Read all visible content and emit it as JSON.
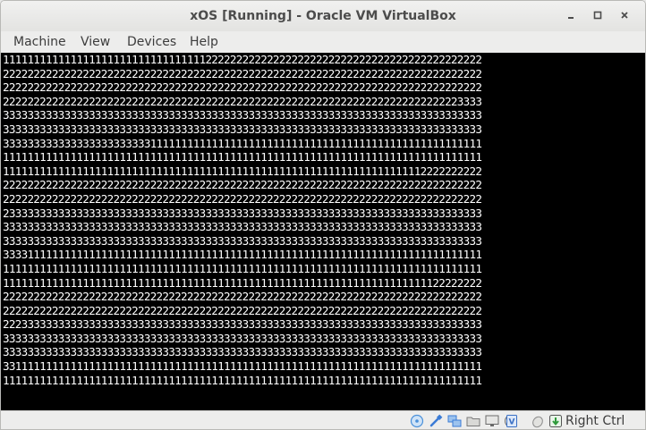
{
  "window": {
    "title": "xOS [Running] - Oracle VM VirtualBox"
  },
  "menubar": {
    "items": [
      {
        "label": "Machine"
      },
      {
        "label": "View"
      },
      {
        "label": "Devices"
      },
      {
        "label": "Help"
      }
    ]
  },
  "vm_screen": {
    "lines": [
      "111111111111111111111111111111111222222222222222222222222222222222222222222222",
      "222222222222222222222222222222222222222222222222222222222222222222222222222222",
      "222222222222222222222222222222222222222222222222222222222222222222222222222222",
      "222222222222222222222222222222222222222222222222222222222222222222222222223333",
      "333333333333333333333333333333333333333333333333333333333333333333333333333333",
      "333333333333333333333333333333333333333333333333333333333333333333333333333333",
      "333333333333333333333333111111111111111111111111111111111111111111111111111111",
      "111111111111111111111111111111111111111111111111111111111111111111111111111111",
      "111111111111111111111111111111111111111111111111111111111111111111112222222222",
      "222222222222222222222222222222222222222222222222222222222222222222222222222222",
      "222222222222222222222222222222222222222222222222222222222222222222222222222222",
      "233333333333333333333333333333333333333333333333333333333333333333333333333333",
      "333333333333333333333333333333333333333333333333333333333333333333333333333333",
      "333333333333333333333333333333333333333333333333333333333333333333333333333333",
      "333311111111111111111111111111111111111111111111111111111111111111111111111111",
      "111111111111111111111111111111111111111111111111111111111111111111111111111111",
      "111111111111111111111111111111111111111111111111111111111111111111111122222222",
      "222222222222222222222222222222222222222222222222222222222222222222222222222222",
      "222222222222222222222222222222222222222222222222222222222222222222222222222222",
      "222333333333333333333333333333333333333333333333333333333333333333333333333333",
      "333333333333333333333333333333333333333333333333333333333333333333333333333333",
      "333333333333333333333333333333333333333333333333333333333333333333333333333333",
      "331111111111111111111111111111111111111111111111111111111111111111111111111111",
      "111111111111111111111111111111111111111111111111111111111111111111111111111111"
    ]
  },
  "statusbar": {
    "icons": [
      {
        "name": "optical-drive-icon",
        "color": "#4a90d9"
      },
      {
        "name": "usb-icon",
        "color": "#3a7bd5"
      },
      {
        "name": "network-icon",
        "color": "#3a7bd5"
      },
      {
        "name": "shared-folder-icon",
        "color": "#7a7a7a"
      },
      {
        "name": "display-icon",
        "color": "#6a6a6a"
      },
      {
        "name": "video-capture-icon",
        "color": "#6a6a6a"
      },
      {
        "name": "cpu-icon",
        "color": "#3a6fc4"
      },
      {
        "name": "mouse-integration-icon",
        "color": "#8a8a8a"
      },
      {
        "name": "keyboard-capture-icon",
        "color": "#2e9a3a"
      }
    ],
    "host_key": "Right Ctrl"
  }
}
